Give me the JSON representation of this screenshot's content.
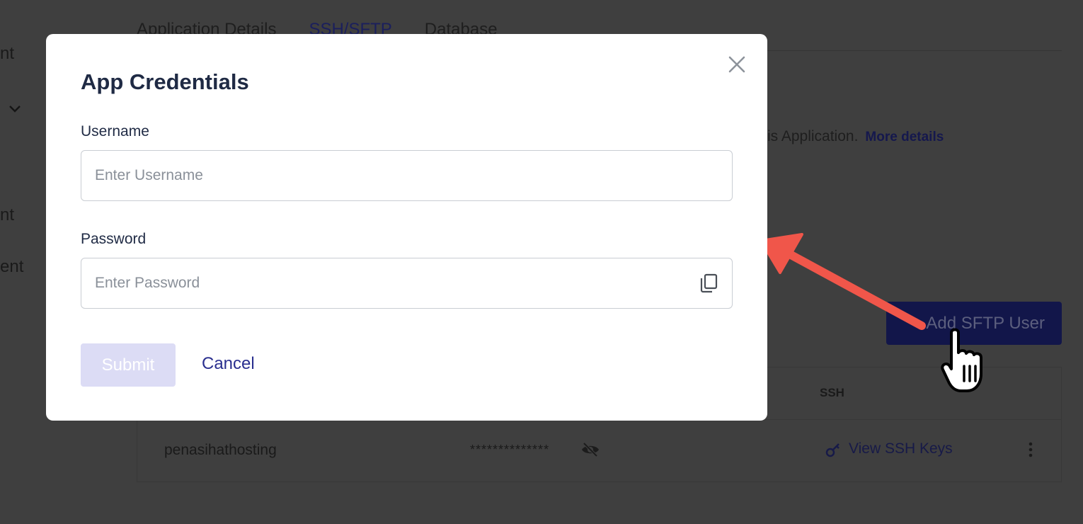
{
  "background": {
    "sidebar_fragments": [
      "nt",
      "nt",
      "ent"
    ],
    "tabs": [
      "Application Details",
      "SSH/SFTP",
      "Database"
    ],
    "active_tab": "SSH/SFTP",
    "description_fragment": "is Application.",
    "more_details_link": "More details",
    "add_sftp_user_button": "Add SFTP User",
    "table": {
      "header_ssh": "SSH",
      "row": {
        "username": "penasihathosting",
        "password_masked": "**************",
        "ssh_link": "View SSH Keys"
      }
    }
  },
  "modal": {
    "title": "App Credentials",
    "username_label": "Username",
    "username_placeholder": "Enter Username",
    "username_value": "",
    "password_label": "Password",
    "password_placeholder": "Enter Password",
    "password_value": "",
    "submit_label": "Submit",
    "cancel_label": "Cancel"
  },
  "colors": {
    "overlay_bg": "#3f3f3f",
    "modal_bg": "#ffffff",
    "title_text": "#1f2a44",
    "submit_disabled": "#dcdcf5",
    "cancel_link": "#2a2f8f",
    "annotation_arrow": "#f0564a"
  },
  "icons": [
    "close-icon",
    "copy-icon",
    "chevron-down-icon",
    "eye-off-icon",
    "key-icon",
    "more-vertical-icon",
    "hand-pointer-icon",
    "annotation-arrow"
  ]
}
